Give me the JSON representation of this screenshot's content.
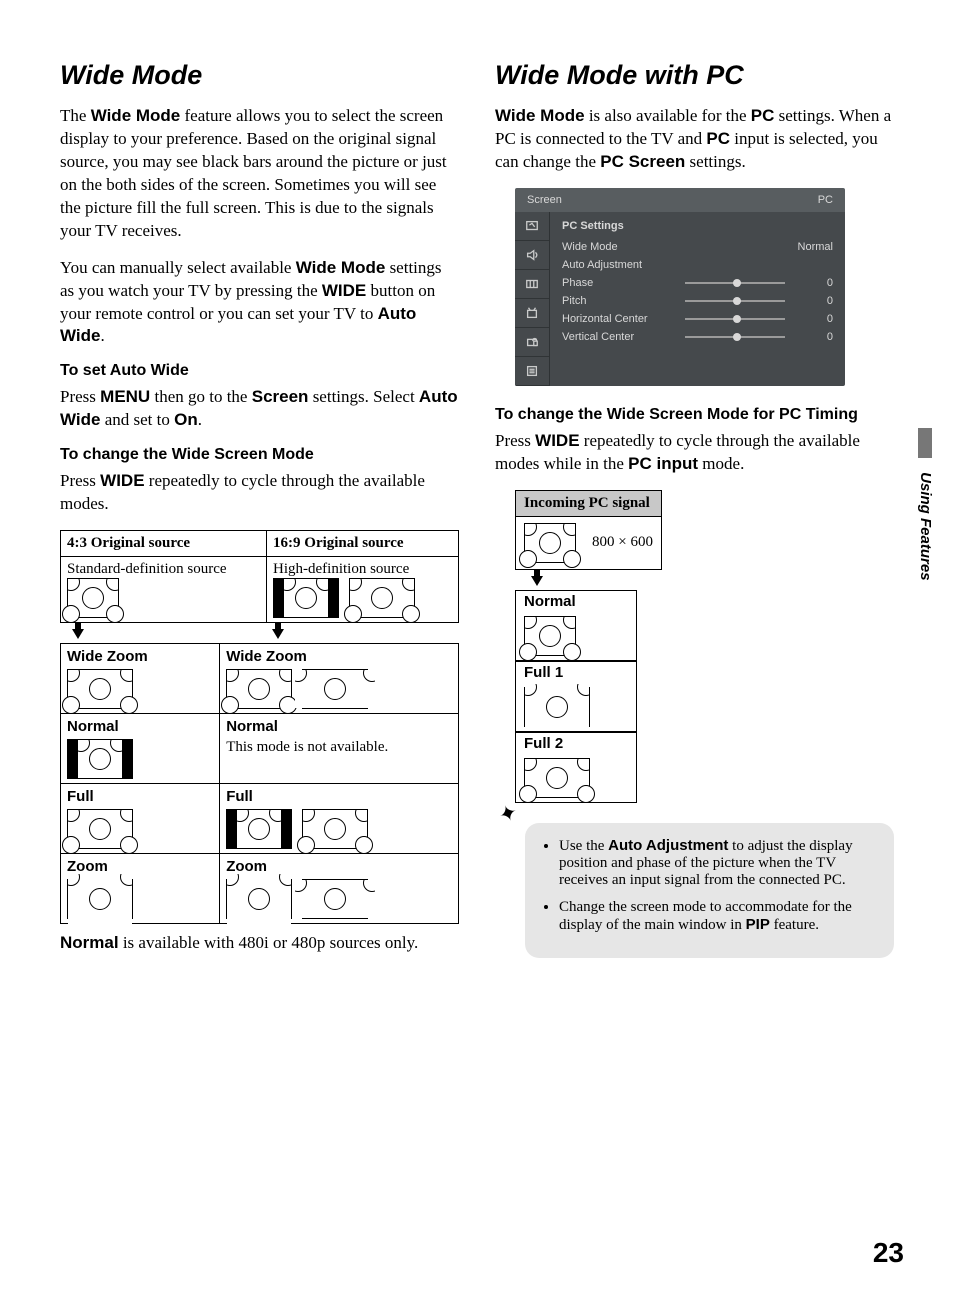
{
  "left": {
    "heading": "Wide Mode",
    "intro_parts": [
      "The ",
      "Wide Mode",
      " feature allows you to select the screen display to your preference. Based on the original signal source, you may see black bars around the picture or just on the both sides of the screen. Sometimes you will see the picture fill the full screen. This is due to the signals your TV receives."
    ],
    "manual_parts": [
      "You can manually select available ",
      "Wide Mode",
      " settings as you watch your TV by pressing the ",
      "WIDE",
      " button on your remote control or you can set your TV to ",
      "Auto Wide",
      "."
    ],
    "autowide_h": "To set Auto Wide",
    "autowide_parts": [
      "Press ",
      "MENU",
      " then go to the ",
      "Screen",
      " settings. Select ",
      "Auto Wide",
      " and set to ",
      "On",
      "."
    ],
    "change_h": "To change the Wide Screen Mode",
    "change_parts": [
      "Press ",
      "WIDE",
      " repeatedly to cycle through the available modes."
    ],
    "table": {
      "h1": "4:3 Original source",
      "h2": "16:9 Original source",
      "r0a": "Standard-definition source",
      "r0b": "High-definition source",
      "modes": [
        "Wide Zoom",
        "Normal",
        "Full",
        "Zoom"
      ],
      "normal_na": "This mode is not available."
    },
    "footnote_parts": [
      "Normal",
      " is available with 480i or 480p sources only."
    ]
  },
  "right": {
    "heading": "Wide Mode with PC",
    "intro_parts": [
      "Wide Mode",
      " is also available for the ",
      "PC",
      " settings. When a PC is connected to the TV and ",
      "PC",
      " input is selected, you can change the ",
      "PC Screen",
      " settings."
    ],
    "osd": {
      "title": "Screen",
      "corner": "PC",
      "section": "PC Settings",
      "rows": [
        {
          "label": "Wide Mode",
          "value": "Normal",
          "slider": false
        },
        {
          "label": "Auto Adjustment",
          "value": "",
          "slider": false
        },
        {
          "label": "Phase",
          "value": "0",
          "slider": true
        },
        {
          "label": "Pitch",
          "value": "0",
          "slider": true
        },
        {
          "label": "Horizontal Center",
          "value": "0",
          "slider": true
        },
        {
          "label": "Vertical Center",
          "value": "0",
          "slider": true
        }
      ]
    },
    "pc_h": "To change the Wide Screen Mode for PC Timing",
    "pc_parts": [
      "Press ",
      "WIDE",
      " repeatedly to cycle through the available modes while in the ",
      "PC input",
      " mode."
    ],
    "pc_table": {
      "header": "Incoming PC signal",
      "res": "800 × 600",
      "modes": [
        "Normal",
        "Full 1",
        "Full 2"
      ]
    },
    "tips": {
      "t1_parts": [
        "Use the ",
        "Auto Adjustment",
        " to adjust the display position and phase of the picture when the TV receives an input signal from the connected PC."
      ],
      "t2_parts": [
        "Change the screen mode to accommodate for the display of the main window in ",
        "PIP",
        " feature."
      ]
    }
  },
  "side_label": "Using Features",
  "page_number": "23"
}
